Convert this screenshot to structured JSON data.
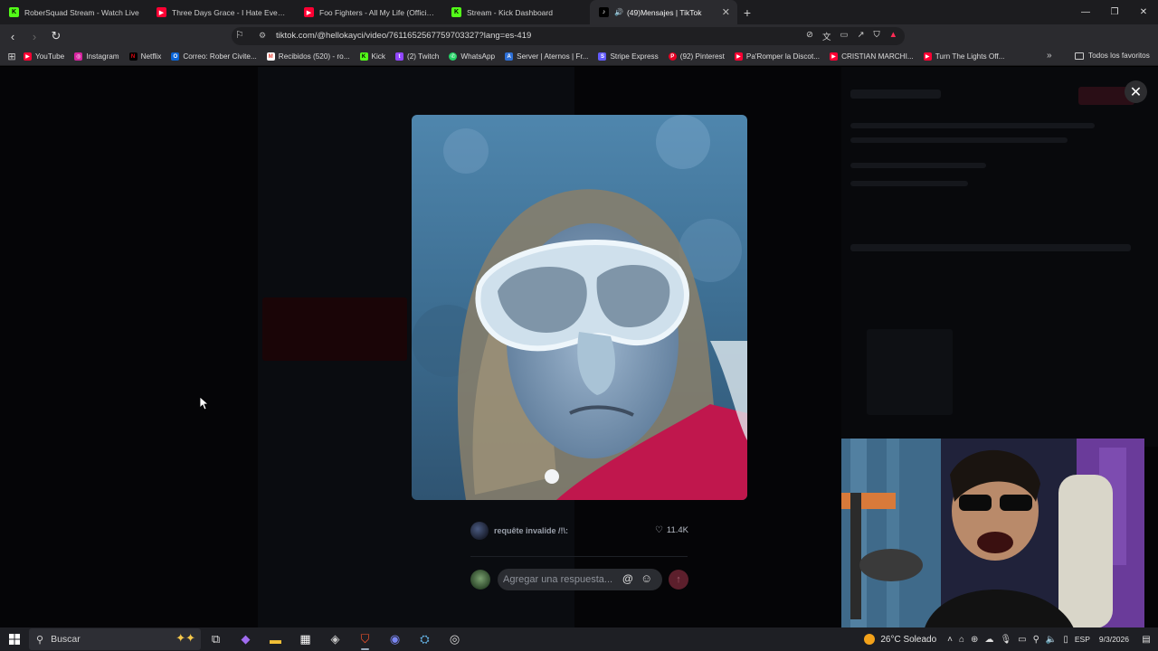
{
  "browser": {
    "tabs": [
      {
        "title": "RoberSquad Stream - Watch Live",
        "icon": "kick-logo",
        "color": "#53fc18"
      },
      {
        "title": "Three Days Grace - I Hate Everything",
        "icon": "youtube-logo",
        "color": "#ff0033"
      },
      {
        "title": "Foo Fighters - All My Life (Official HD",
        "icon": "youtube-logo",
        "color": "#ff0033"
      },
      {
        "title": "Stream - Kick Dashboard",
        "icon": "kick-logo",
        "color": "#53fc18"
      },
      {
        "title": "(49)Mensajes | TikTok",
        "icon": "tiktok-logo",
        "color": "#ffffff",
        "active": true
      }
    ],
    "url": "tiktok.com/@hellokayci/video/7611652567759703327?lang=es-419",
    "bookmarks": [
      {
        "label": "YouTube",
        "color": "#ff0033"
      },
      {
        "label": "Instagram",
        "color": "#d6249f"
      },
      {
        "label": "Netflix",
        "color": "#e50914"
      },
      {
        "label": "Correo: Rober Civite...",
        "color": "#0a64d6"
      },
      {
        "label": "Recibidos (520) - ro...",
        "color": "#ea4335"
      },
      {
        "label": "Kick",
        "color": "#53fc18"
      },
      {
        "label": "(2) Twitch",
        "color": "#9146ff"
      },
      {
        "label": "WhatsApp",
        "color": "#25d366"
      },
      {
        "label": "Server | Aternos | Fr...",
        "color": "#2d6fd6"
      },
      {
        "label": "Stripe Express",
        "color": "#635bff"
      },
      {
        "label": "(92) Pinterest",
        "color": "#e60023"
      },
      {
        "label": "Pa'Romper la Discot...",
        "color": "#ff0033"
      },
      {
        "label": "CRISTIAN MARCHI...",
        "color": "#ff0033"
      },
      {
        "label": "Turn The Lights Off...",
        "color": "#ff0033"
      }
    ],
    "all_bookmarks": "Todos los favoritos"
  },
  "reply": {
    "username": "requête invalide /!\\:",
    "likes": "11.4K"
  },
  "compose": {
    "placeholder": "Agregar una respuesta..."
  },
  "taskbar": {
    "search_label": "Buscar",
    "weather": "26°C  Soleado",
    "language": "ESP",
    "date": "9/3/2026"
  },
  "colors": {
    "accent": "#fe2c55",
    "send_disabled": "#5c1f2c"
  }
}
